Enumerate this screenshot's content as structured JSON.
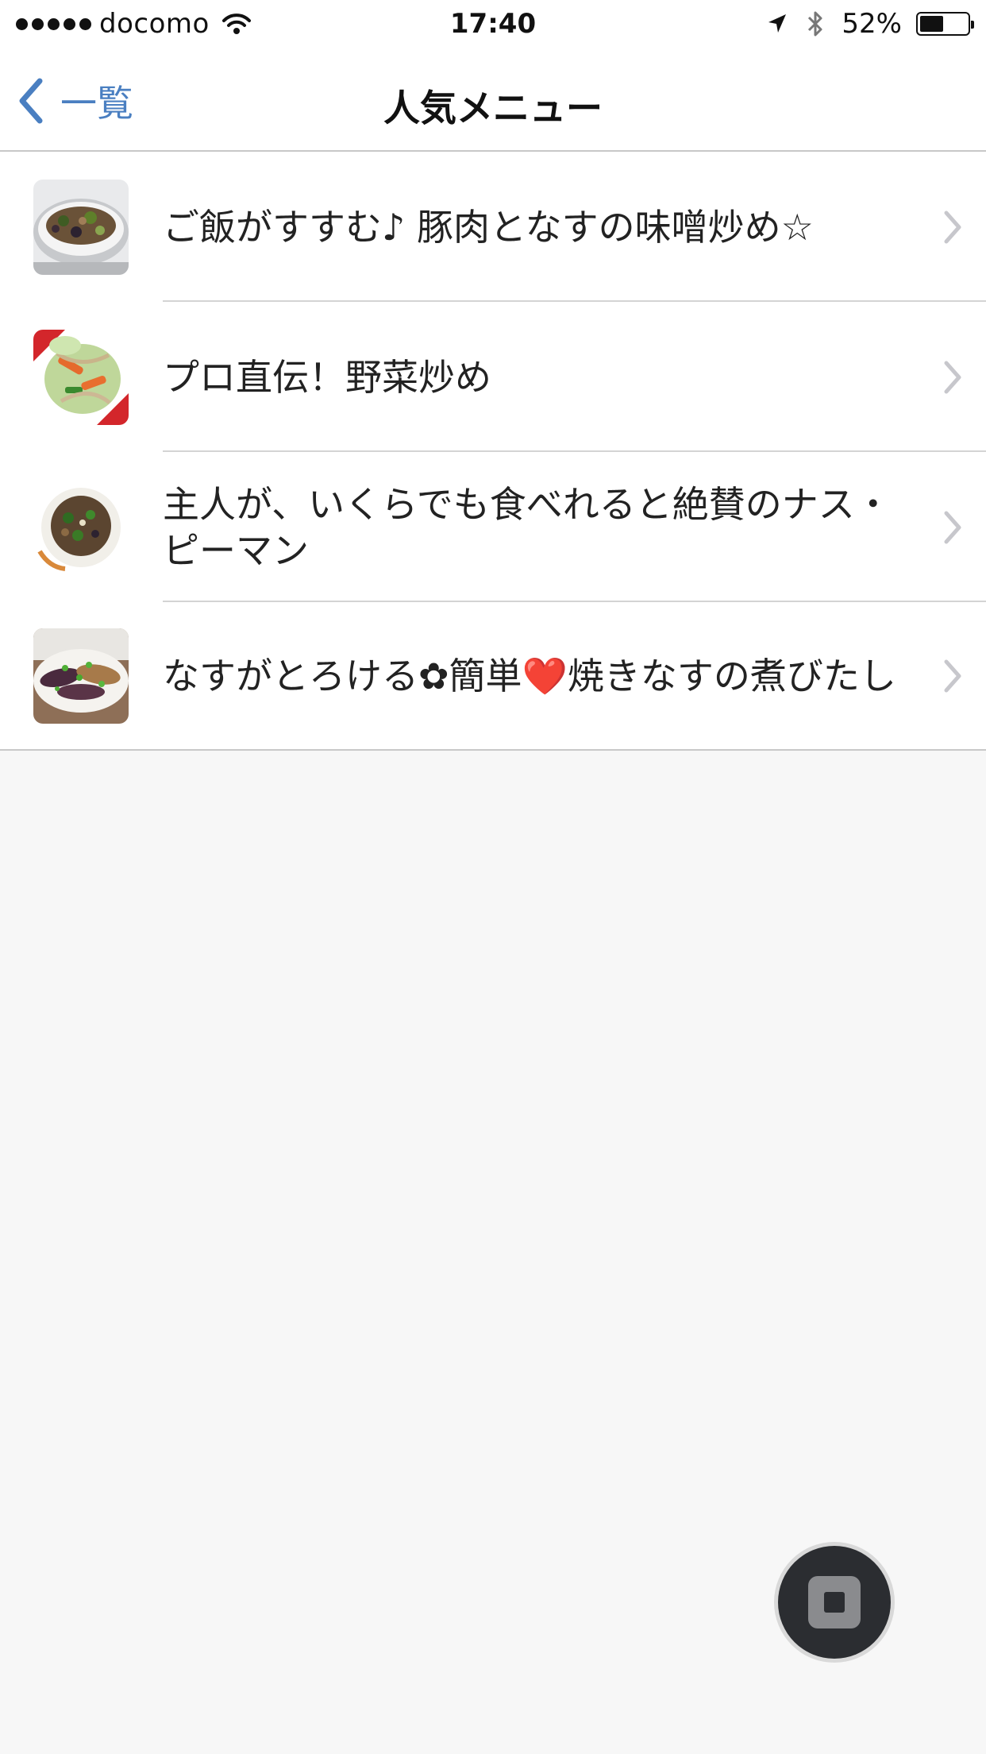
{
  "status_bar": {
    "carrier": "docomo",
    "time": "17:40",
    "battery_percent": "52%",
    "battery_level": 0.52,
    "icons": [
      "signal-dots-icon",
      "wifi-icon",
      "location-arrow-icon",
      "bluetooth-icon",
      "battery-icon"
    ]
  },
  "nav": {
    "back_label": "一覧",
    "title": "人気メニュー",
    "accent_color": "#4a7fc1"
  },
  "menu": {
    "items": [
      {
        "title": "ご飯がすすむ♪ 豚肉となすの味噌炒め☆",
        "thumbnail": "pork-eggplant-miso-photo"
      },
      {
        "title": "プロ直伝！野菜炒め",
        "thumbnail": "stir-fried-vegetables-photo"
      },
      {
        "title": "主人が、いくらでも食べれると絶賛のナス・ピーマン",
        "thumbnail": "eggplant-pepper-photo"
      },
      {
        "title": "なすがとろける✿簡単❤️焼きなすの煮びたし",
        "thumbnail": "grilled-eggplant-photo"
      }
    ]
  },
  "float_button": {
    "icon": "stop-icon"
  }
}
